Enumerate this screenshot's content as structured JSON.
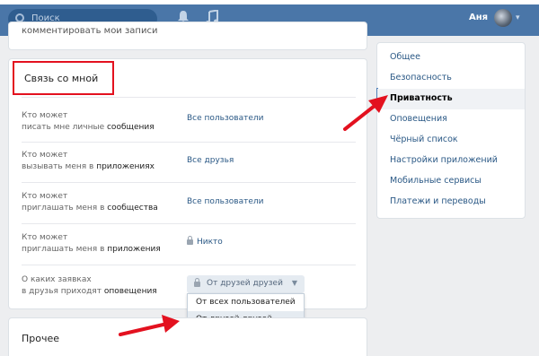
{
  "header": {
    "search_placeholder": "Поиск",
    "bell_icon": "bell-icon",
    "music_icon": "music-note-icon",
    "user_name": "Аня",
    "brand_color": "#4a76a8"
  },
  "top_card": {
    "clipped_text": "комментировать мои записи"
  },
  "contact": {
    "title": "Связь со мной",
    "rows": [
      {
        "label_line1": "Кто может",
        "label_line2_pre": "писать мне личные ",
        "label_line2_bold": "сообщения",
        "value": "Все пользователи"
      },
      {
        "label_line1": "Кто может",
        "label_line2_pre": "вызывать меня в ",
        "label_line2_bold": "приложениях",
        "value": "Все друзья"
      },
      {
        "label_line1": "Кто может",
        "label_line2_pre": "приглашать меня в ",
        "label_line2_bold": "сообщества",
        "value": "Все пользователи"
      },
      {
        "label_line1": "Кто может",
        "label_line2_pre": "приглашать меня в ",
        "label_line2_bold": "приложения",
        "value": "Никто"
      }
    ],
    "invites": {
      "label_line1": "О каких заявках",
      "label_line2_pre": "в друзья приходят ",
      "label_line2_bold": "оповещения",
      "selected": "От друзей друзей",
      "options": [
        "От всех пользователей",
        "От друзей друзей"
      ]
    }
  },
  "other": {
    "title": "Прочее"
  },
  "right_menu": {
    "items": [
      "Общее",
      "Безопасность",
      "Приватность",
      "Оповещения",
      "Чёрный список",
      "Настройки приложений",
      "Мобильные сервисы",
      "Платежи и переводы"
    ],
    "active": "Приватность"
  },
  "annotation_color": "#e3111f"
}
